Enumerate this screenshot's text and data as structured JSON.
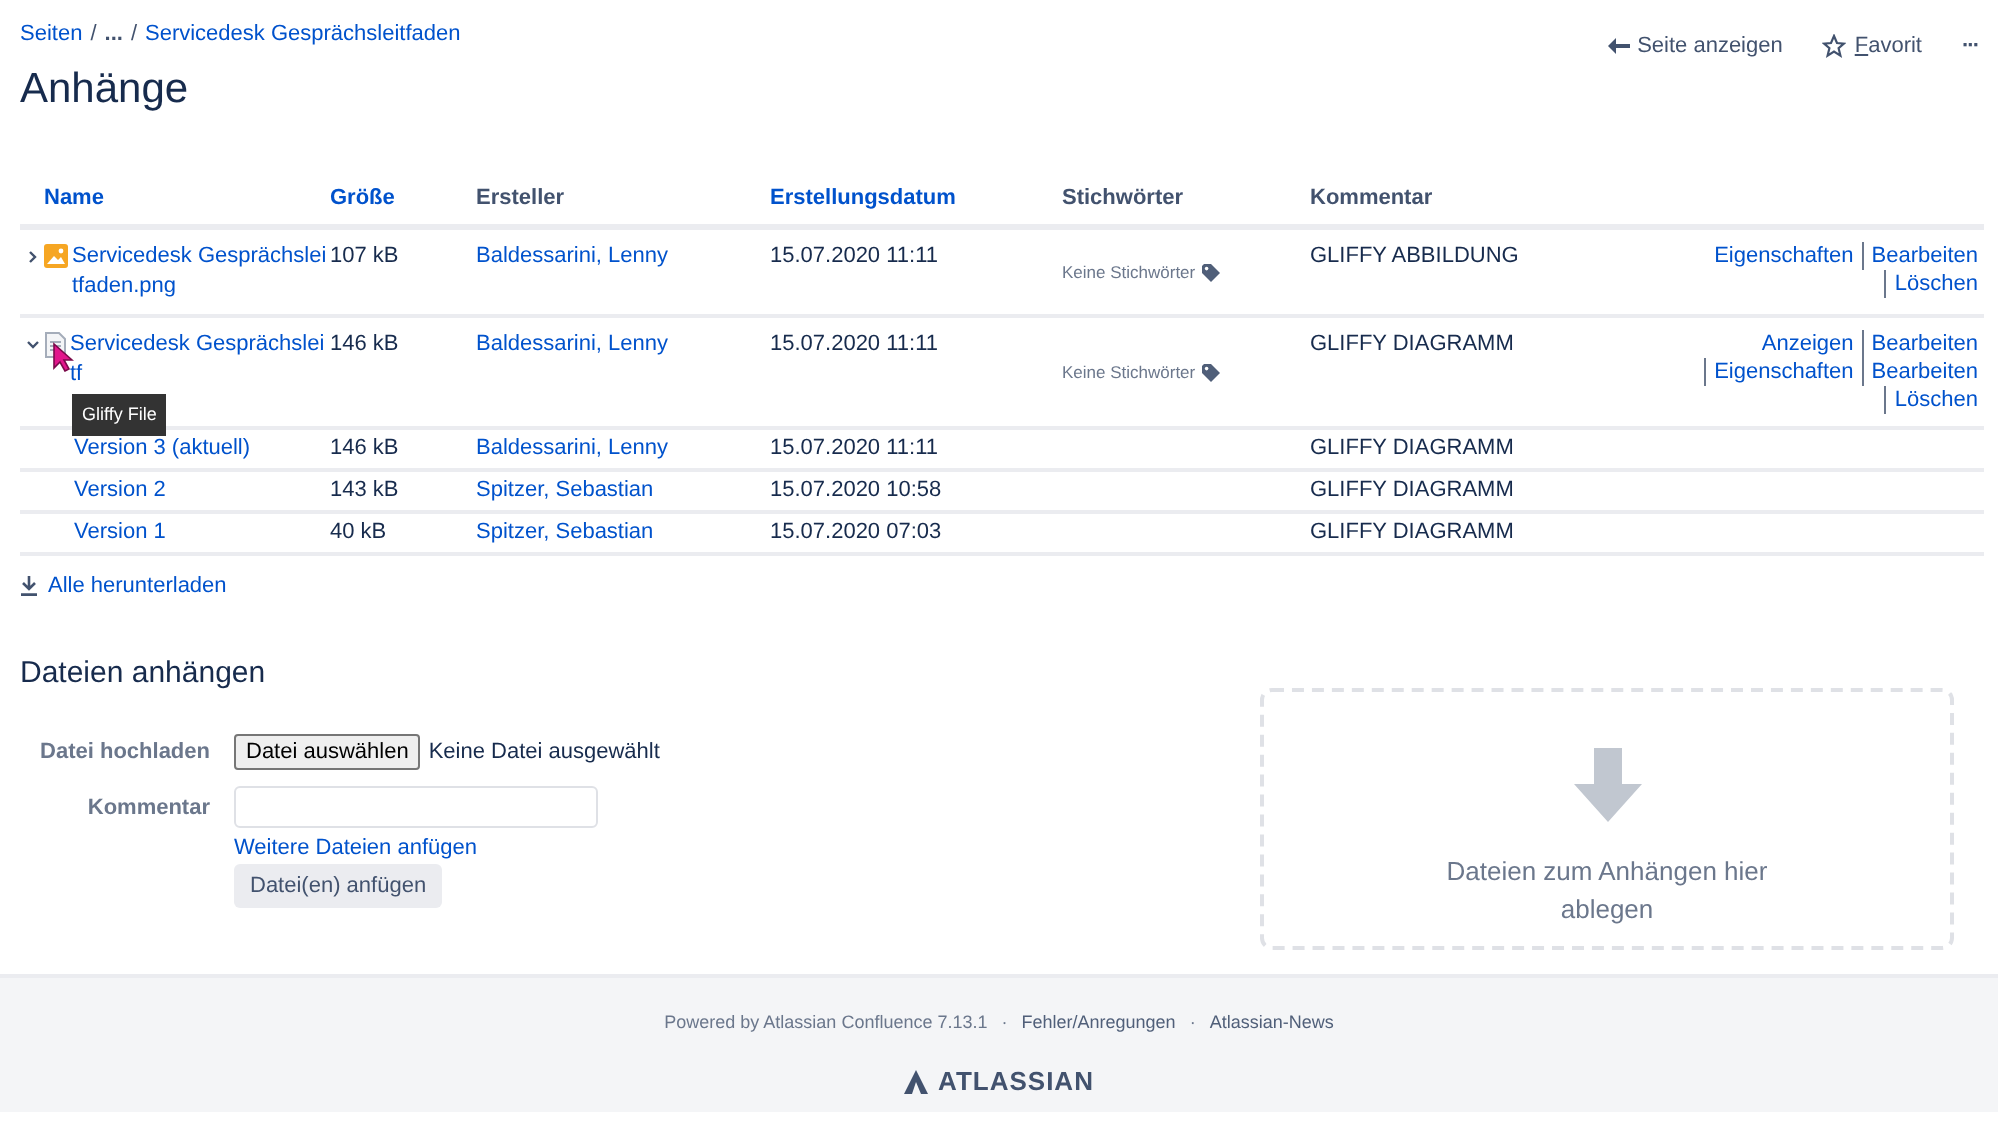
{
  "breadcrumb": [
    {
      "label": "Seiten"
    },
    {
      "label": "..."
    },
    {
      "label": "Servicedesk Gesprächsleitfaden"
    }
  ],
  "breadcrumb_separator": "/",
  "header_actions": [
    {
      "kind": "view",
      "label": "Seite anzeigen"
    },
    {
      "kind": "favorite",
      "label": "Favorit"
    },
    {
      "kind": "more",
      "label": "···"
    }
  ],
  "title": "Anhänge",
  "table": {
    "columns": [
      {
        "label": "Name",
        "sortable": true
      },
      {
        "label": "Größe",
        "sortable": true
      },
      {
        "label": "Ersteller",
        "sortable": false
      },
      {
        "label": "Erstellungsdatum",
        "sortable": true
      },
      {
        "label": "Stichwörter",
        "sortable": false
      },
      {
        "label": "Kommentar",
        "sortable": false
      }
    ],
    "rows": [
      {
        "kind": "image",
        "expanded": false,
        "name": [
          "Servicedesk Gesprächslei",
          "tfaden.png"
        ],
        "size": "107 kB",
        "creator": "Baldessarini, Lenny",
        "date": "15.07.2020 11:11",
        "labels": "Keine Stichwörter",
        "comment": "GLIFFY ABBILDUNG",
        "actions": [
          [
            "Eigenschaften",
            "Bearbeiten"
          ],
          [
            "Löschen"
          ]
        ],
        "versions": []
      },
      {
        "kind": "gliffy",
        "expanded": true,
        "name": [
          "Servicedesk Gesprächslei",
          "tf"
        ],
        "size": "146 kB",
        "creator": "Baldessarini, Lenny",
        "date": "15.07.2020 11:11",
        "labels": "Keine Stichwörter",
        "comment": "GLIFFY DIAGRAMM",
        "actions": [
          [
            "Anzeigen",
            "Bearbeiten"
          ],
          [
            "Eigenschaften",
            "Bearbeiten"
          ],
          [
            "Löschen"
          ]
        ],
        "tooltip": "Gliffy File",
        "versions": [
          {
            "name": "Version 3 (aktuell)",
            "size": "146 kB",
            "creator": "Baldessarini, Lenny",
            "date": "15.07.2020 11:11",
            "comment": "GLIFFY DIAGRAMM"
          },
          {
            "name": "Version 2",
            "size": "143 kB",
            "creator": "Spitzer, Sebastian",
            "date": "15.07.2020 10:58",
            "comment": "GLIFFY DIAGRAMM"
          },
          {
            "name": "Version 1",
            "size": "40 kB",
            "creator": "Spitzer, Sebastian",
            "date": "15.07.2020 07:03",
            "comment": "GLIFFY DIAGRAMM"
          }
        ]
      }
    ]
  },
  "download_all": "Alle herunterladen",
  "upload": {
    "heading": "Dateien anhängen",
    "file_label": "Datei hochladen",
    "choose_button": "Datei auswählen",
    "no_file": "Keine Datei ausgewählt",
    "comment_label": "Kommentar",
    "more_files": "Weitere Dateien anfügen",
    "submit": "Datei(en) anfügen",
    "dropzone": "Dateien zum Anhängen hier ablegen"
  },
  "footer": {
    "powered": "Powered by Atlassian Confluence 7.13.1",
    "links": [
      "Fehler/Anregungen",
      "Atlassian-News"
    ],
    "separator": "·",
    "logo": "ATLASSIAN"
  }
}
